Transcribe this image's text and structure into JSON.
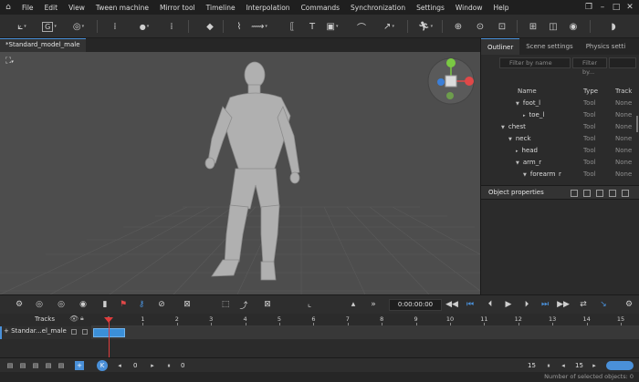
{
  "menu": {
    "items": [
      "File",
      "Edit",
      "View",
      "Tween machine",
      "Mirror tool",
      "Timeline",
      "Interpolation",
      "Commands",
      "Synchronization",
      "Settings",
      "Window",
      "Help"
    ]
  },
  "toolbar": {
    "gizmo_label": "G"
  },
  "document_tab": {
    "title": "*Standard_model_male"
  },
  "outliner": {
    "tabs": [
      "Outliner",
      "Scene settings",
      "Physics setti"
    ],
    "search_name_placeholder": "Filter by name",
    "search_type_placeholder": "Filter by...",
    "columns": {
      "name": "Name",
      "type": "Type",
      "track": "Track"
    },
    "rows": [
      {
        "name": "foot_l",
        "type": "Tool",
        "track": "None"
      },
      {
        "name": "toe_l",
        "type": "Tool",
        "track": "None"
      },
      {
        "name": "chest",
        "type": "Tool",
        "track": "None"
      },
      {
        "name": "neck",
        "type": "Tool",
        "track": "None"
      },
      {
        "name": "head",
        "type": "Tool",
        "track": "None"
      },
      {
        "name": "arm_r",
        "type": "Tool",
        "track": "None"
      },
      {
        "name": "forearm_r",
        "type": "Tool",
        "track": "None"
      }
    ]
  },
  "object_properties": {
    "title": "Object properties"
  },
  "timeline": {
    "time_display": "0:00:00:00",
    "tracks_label": "Tracks",
    "track_name": "Standar...el_male",
    "ruler": [
      "0",
      "1",
      "2",
      "3",
      "4",
      "5",
      "6",
      "7",
      "8",
      "9",
      "10",
      "11",
      "12",
      "13",
      "14",
      "15"
    ],
    "playhead_frame": 0
  },
  "bottom": {
    "current_frame": "0",
    "start_frame": "0",
    "end_frame": "15",
    "range_end": "15"
  },
  "status": {
    "text": "Number of selected objects: 0"
  },
  "colors": {
    "accent": "#4a90d9",
    "clip": "#3b8fd8",
    "playhead": "#e03c3c",
    "viewport_bg": "#4d4d4d"
  }
}
